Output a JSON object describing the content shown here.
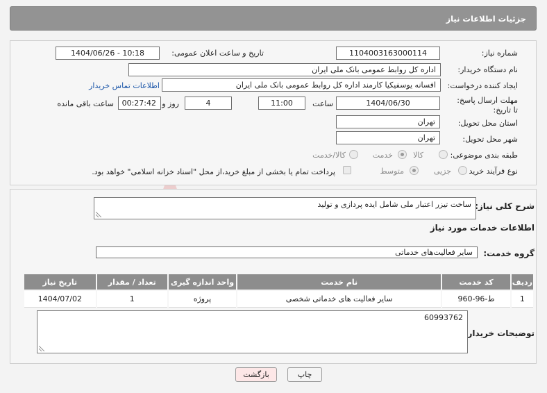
{
  "header": {
    "title": "جزئیات اطلاعات نیاز"
  },
  "fields": {
    "need_number": {
      "label": "شماره نیاز:",
      "value": "1104003163000114"
    },
    "announce_date": {
      "label": "تاریخ و ساعت اعلان عمومی:",
      "value": "1404/06/26 - 10:18"
    },
    "buyer_org": {
      "label": "نام دستگاه خریدار:",
      "value": "اداره کل روابط عمومی بانک ملی ایران"
    },
    "requester": {
      "label": "ایجاد کننده درخواست:",
      "value": "افسانه یوسفیکیا کارمند اداره کل روابط عمومی بانک ملی ایران",
      "contact_link": "اطلاعات تماس خریدار"
    },
    "deadline": {
      "label": "مهلت ارسال پاسخ: تا تاریخ:",
      "date": "1404/06/30",
      "time_label": "ساعت",
      "time": "11:00",
      "days": "4",
      "days_label": "روز و",
      "remaining": "00:27:42",
      "remaining_label": "ساعت باقی مانده"
    },
    "province": {
      "label": "استان محل تحویل:",
      "value": "تهران"
    },
    "city": {
      "label": "شهر محل تحویل:",
      "value": "تهران"
    },
    "category": {
      "label": "طبقه بندی موضوعی:",
      "options": [
        "کالا",
        "خدمت",
        "کالا/خدمت"
      ],
      "selected": "خدمت"
    },
    "purchase_type": {
      "label": "نوع فرآیند خرید :",
      "options": [
        "جزیی",
        "متوسط"
      ],
      "selected": "متوسط",
      "note": "پرداخت تمام یا بخشی از مبلغ خرید،از محل \"اسناد خزانه اسلامی\" خواهد بود."
    }
  },
  "summary": {
    "label": "شرح کلی نیاز:",
    "value": "ساخت تیزر اعتبار ملی شامل ایده پردازی و تولید"
  },
  "services": {
    "section_title": "اطلاعات خدمات مورد نیاز",
    "group_label": "گروه خدمت:",
    "group_value": "سایر فعالیت‌های خدماتی",
    "columns": [
      "ردیف",
      "کد خدمت",
      "نام خدمت",
      "واحد اندازه گیری",
      "تعداد / مقدار",
      "تاریخ نیاز"
    ],
    "rows": [
      [
        "1",
        "ط-96-960",
        "سایر فعالیت های خدماتی شخصی",
        "پروژه",
        "1",
        "1404/07/02"
      ]
    ]
  },
  "buyer_notes": {
    "label": "توضیحات خریدار:",
    "value": "60993762"
  },
  "buttons": {
    "print": "چاپ",
    "back": "بازگشت"
  },
  "watermark": {
    "text": "AriaTender.neT"
  },
  "colors": {
    "header": "#939393",
    "table_header": "#8d8d8d",
    "link": "#1a55a8",
    "back_button": "#fde7e7"
  }
}
